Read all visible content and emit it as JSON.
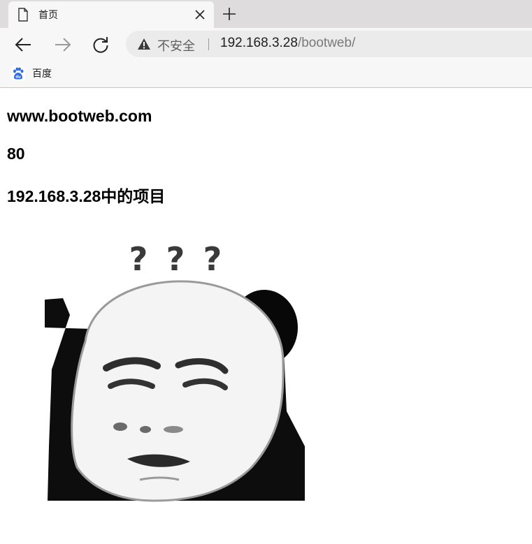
{
  "browser": {
    "tab": {
      "title": "首页",
      "page_icon": "document-icon",
      "close_icon": "close-icon"
    },
    "new_tab_icon": "plus-icon",
    "nav": {
      "back_icon": "arrow-left-icon",
      "forward_icon": "arrow-right-icon",
      "reload_icon": "reload-icon"
    },
    "address_bar": {
      "security_icon": "warning-triangle-icon",
      "security_label": "不安全",
      "url_host": "192.168.3.28",
      "url_path": "/bootweb/"
    },
    "bookmarks": [
      {
        "label": "百度",
        "icon": "baidu-paw-icon"
      }
    ]
  },
  "page": {
    "site_name": "www.bootweb.com",
    "port": "80",
    "project_heading": "192.168.3.28中的项目",
    "image": {
      "subject": "panda-meme-image",
      "question_marks": [
        "?",
        "?",
        "?"
      ]
    }
  },
  "colors": {
    "chrome_bg": "#f7f7f7",
    "tabstrip_bg": "#dedcdc",
    "omnibox_bg": "#ebebeb",
    "baidu_blue": "#2f6de3"
  }
}
